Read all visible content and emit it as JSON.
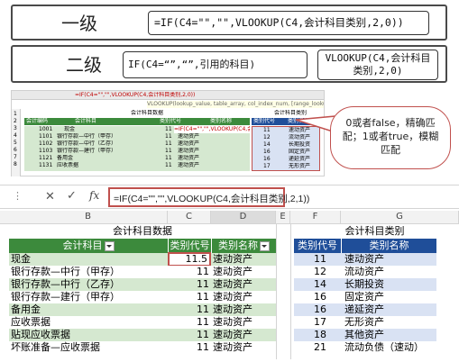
{
  "level1": {
    "title": "一级",
    "formula": "=IF(C4=\"\",\"\",VLOOKUP(C4,会计科目类别,2,0))"
  },
  "level2": {
    "title": "二级",
    "formula_left": "IF(C4=“”,“”,引用的科目)",
    "formula_right": "VLOOKUP(C4,会计科目类别,2,0)"
  },
  "small_sheet": {
    "fx_text": "=IF(C4=\"\",\"\",VLOOKUP(C4,会计科目类别,2,0))",
    "tooltip": "VLOOKUP(lookup_value, table_array, col_index_num, [range_lookup])",
    "title_left": "会计科目数据",
    "title_right": "会计科目类别",
    "headers_left": [
      "会计编码",
      "会计科目",
      "类别代号",
      "类别名称"
    ],
    "headers_right": [
      "类别代号",
      "类别名称"
    ],
    "row_numbers": [
      "1",
      "2",
      "3",
      "4",
      "5",
      "6",
      "7",
      "8"
    ],
    "rows_left": [
      [
        "1001",
        "现金",
        "11",
        "=IF(C4=\"\",\"\",VLOOKUP(C4,会计科目类别,2,0))"
      ],
      [
        "1101",
        "银行存款—中行（甲存）",
        "11",
        "速动资产"
      ],
      [
        "1102",
        "银行存款—中行（乙存）",
        "11",
        "速动资产"
      ],
      [
        "1103",
        "银行存款—建行（甲存）",
        "11",
        "速动资产"
      ],
      [
        "1121",
        "备用金",
        "11",
        "速动资产"
      ],
      [
        "1131",
        "应收票据",
        "11",
        "速动资产"
      ]
    ],
    "rows_right": [
      [
        "11",
        "速动资产"
      ],
      [
        "12",
        "流动资产"
      ],
      [
        "14",
        "长期投资"
      ],
      [
        "16",
        "固定资产"
      ],
      [
        "16",
        "递延资产"
      ],
      [
        "17",
        "无形资产"
      ]
    ]
  },
  "callout": {
    "text": "0或者false，精确匹配；1或者true，模糊匹配"
  },
  "formula_bar": {
    "cancel_icon": "✕",
    "confirm_icon": "✓",
    "fx_label": "fx",
    "formula": "=IF(C4=\"\",\"\",VLOOKUP(C4,会计科目类别,2,1))"
  },
  "big_sheet": {
    "col_headers": [
      "B",
      "C",
      "D",
      "E",
      "F",
      "G"
    ],
    "title_left": "会计科目数据",
    "title_right": "会计科目类别",
    "header_left": [
      "会计科目",
      "类别代号",
      "类别名称"
    ],
    "header_right": [
      "类别代号",
      "类别名称"
    ],
    "rows_left": [
      [
        "现金",
        "11.5",
        "速动资产"
      ],
      [
        "银行存款—中行（甲存）",
        "11",
        "速动资产"
      ],
      [
        "银行存款—中行（乙存）",
        "11",
        "速动资产"
      ],
      [
        "银行存款—建行（甲存）",
        "11",
        "速动资产"
      ],
      [
        "备用金",
        "11",
        "速动资产"
      ],
      [
        "应收票据",
        "11",
        "速动资产"
      ],
      [
        "贴现应收票据",
        "11",
        "速动资产"
      ],
      [
        "坏账准备—应收票据",
        "11",
        "速动资产"
      ]
    ],
    "rows_right": [
      [
        "11",
        "速动资产"
      ],
      [
        "12",
        "流动资产"
      ],
      [
        "14",
        "长期投资"
      ],
      [
        "16",
        "固定资产"
      ],
      [
        "16",
        "递延资产"
      ],
      [
        "17",
        "无形资产"
      ],
      [
        "18",
        "其他资产"
      ],
      [
        "21",
        "流动负债（速动）"
      ]
    ]
  },
  "colors": {
    "green_header": "#3c8a3c",
    "blue_header": "#1f4e99",
    "green_band": "#d5e8d0",
    "blue_band": "#d9e2f3",
    "highlight_red": "#c0504d"
  }
}
